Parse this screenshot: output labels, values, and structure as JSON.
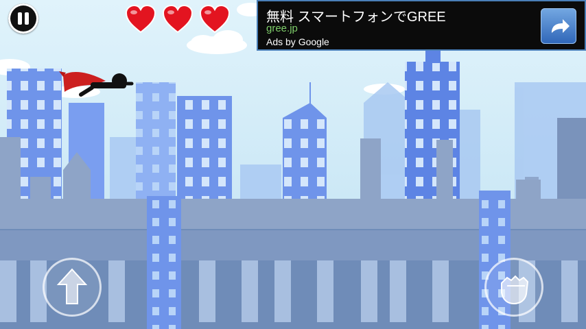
{
  "hud": {
    "pause_icon": "pause-icon",
    "lives": 3,
    "heart_color": "#e31420"
  },
  "ad": {
    "title": "無料 スマートフォンでGREE",
    "url": "gree.jp",
    "credit": "Ads by Google",
    "action_icon": "share-arrow-icon"
  },
  "controls": {
    "jump_icon": "up-arrow-icon",
    "punch_icon": "fist-icon"
  },
  "colors": {
    "sky": "#cfe9f7",
    "building": "#6f94ea",
    "rooftop": "#8ea4c7",
    "cape": "#cc1f1f"
  }
}
